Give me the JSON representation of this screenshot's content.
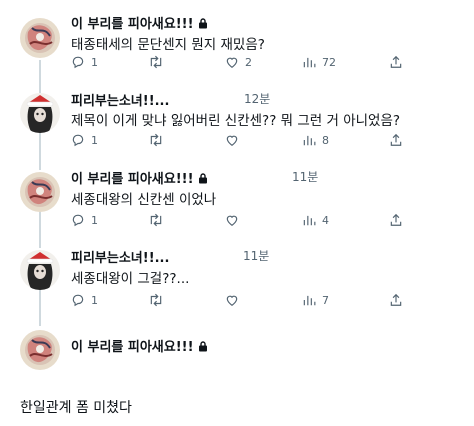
{
  "tweets": [
    {
      "name": "이 부리를 피아새요!!!",
      "time": "",
      "text": "태종태세의 문단센지 뭔지 재밌음?",
      "actions": {
        "reply": "1",
        "retweet": "",
        "like": "2",
        "views": "72"
      }
    },
    {
      "name": "피리부는소녀!!...",
      "time": "12분",
      "text": "제목이 이게 맞냐 잃어버린 신칸센?? 뭐 그런 거 아니었음?",
      "actions": {
        "reply": "1",
        "retweet": "",
        "like": "",
        "views": "8"
      }
    },
    {
      "name": "이 부리를 피아새요!!!",
      "time": "11분",
      "text": "세종대왕의 신칸센 이었나",
      "actions": {
        "reply": "1",
        "retweet": "",
        "like": "",
        "views": "4"
      }
    },
    {
      "name": "피리부는소녀!!...",
      "time": "11분",
      "text": "세종대왕이 그걸??...",
      "actions": {
        "reply": "1",
        "retweet": "",
        "like": "",
        "views": "7"
      }
    },
    {
      "name": "이 부리를 피아새요!!!",
      "time": "",
      "text": "",
      "actions": null
    }
  ],
  "footer_text": "한일관계 폼 미쳤다",
  "icons": {
    "lock": "lock-icon",
    "reply": "reply-icon",
    "retweet": "retweet-icon",
    "like": "heart-icon",
    "views": "views-icon",
    "share": "share-icon"
  },
  "colors": {
    "text": "#0f1419",
    "muted": "#536471",
    "thread_line": "#cfd9de"
  }
}
